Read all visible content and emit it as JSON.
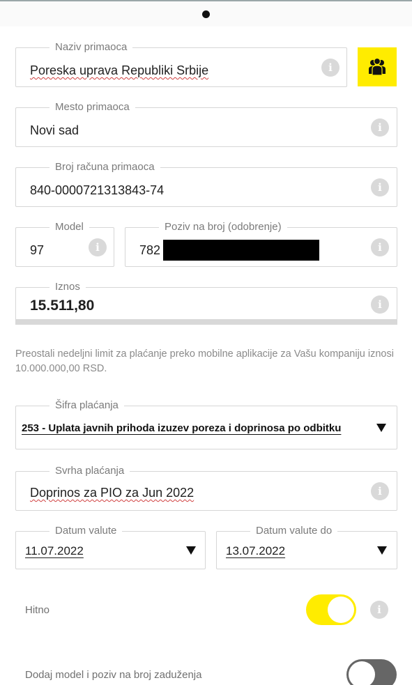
{
  "recipient": {
    "name_label": "Naziv primaoca",
    "name_value": "Poreska uprava Republiki Srbije",
    "place_label": "Mesto primaoca",
    "place_value": "Novi sad",
    "account_label": "Broj računa primaoca",
    "account_value": "840-0000721313843-74"
  },
  "model": {
    "label": "Model",
    "value": "97"
  },
  "reference": {
    "label": "Poziv na broj (odobrenje)",
    "value_visible": "782"
  },
  "amount": {
    "label": "Iznos",
    "value": "15.511,80"
  },
  "limit_note": "Preostali nedeljni limit za plaćanje preko mobilne aplikacije za Vašu kompaniju iznosi 10.000.000,00 RSD.",
  "payment_code": {
    "label": "Šifra plaćanja",
    "value": "253 - Uplata javnih prihoda izuzev  poreza i doprinosa po odbitku"
  },
  "purpose": {
    "label": "Svrha plaćanja",
    "value": "Doprinos za PIO za Jun 2022"
  },
  "value_date": {
    "label": "Datum valute",
    "value": "11.07.2022"
  },
  "value_date_to": {
    "label": "Datum valute do",
    "value": "13.07.2022"
  },
  "urgent": {
    "label": "Hitno",
    "state": "on",
    "on_color": "#ffec00"
  },
  "debt_model": {
    "label": "Dodaj model i poziv na broj zaduženja",
    "state": "off",
    "off_color": "#666666"
  },
  "icons": {
    "info": "info-icon",
    "contacts": "contacts-group-icon",
    "dropdown": "caret-down-icon"
  },
  "info_glyph": "i",
  "colors": {
    "accent": "#ffec00",
    "border": "#d6d6d6",
    "muted_text": "#8a8a8a"
  }
}
